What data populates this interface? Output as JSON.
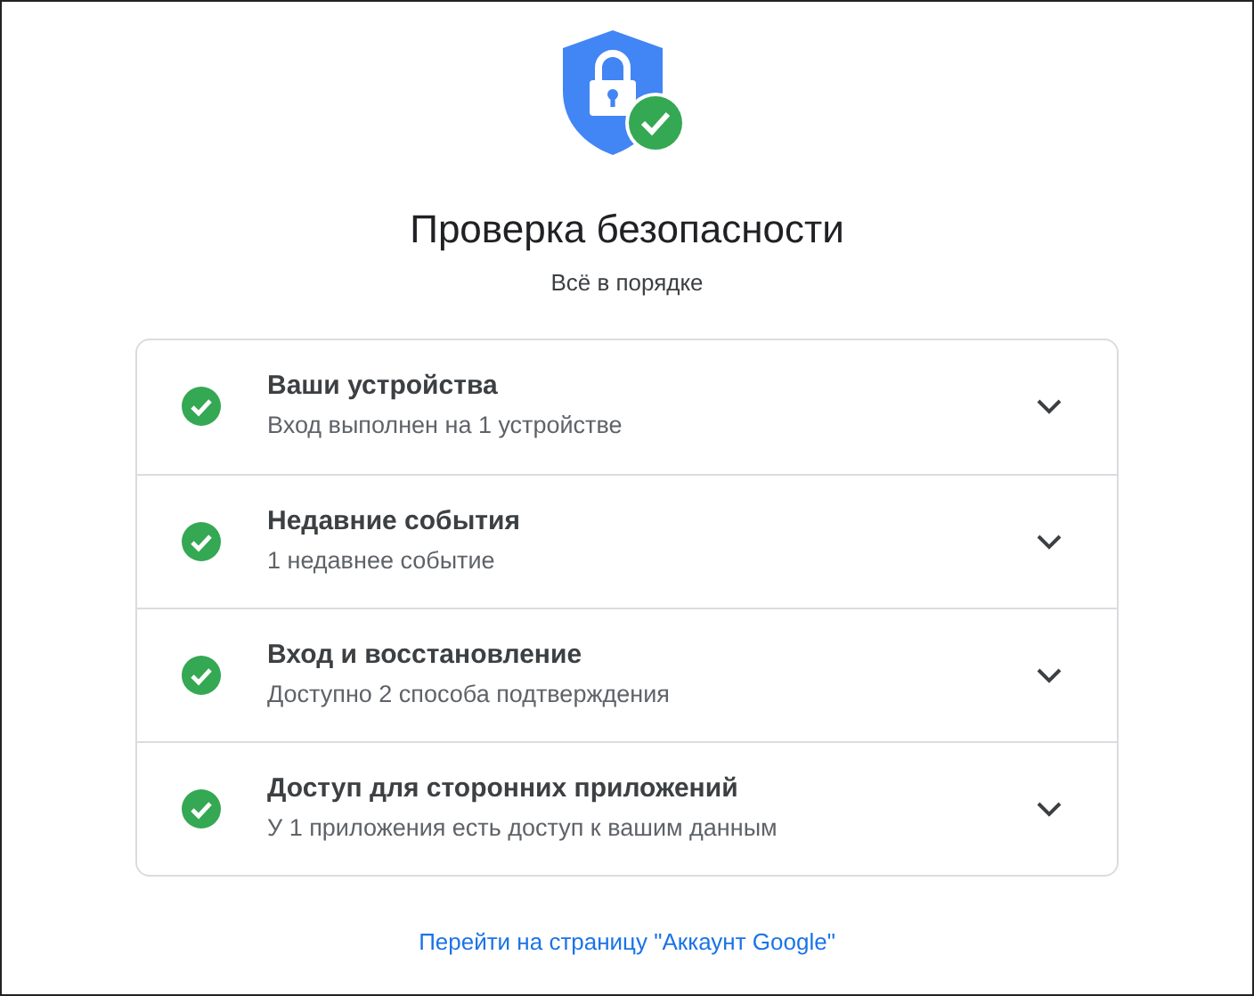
{
  "header": {
    "title": "Проверка безопасности",
    "subtitle": "Всё в порядке"
  },
  "items": [
    {
      "title": "Ваши устройства",
      "detail": "Вход выполнен на 1 устройстве",
      "expanded": false
    },
    {
      "title": "Недавние события",
      "detail": "1 недавнее событие",
      "expanded": false
    },
    {
      "title": "Вход и восстановление",
      "detail": "Доступно 2 способа подтверждения",
      "expanded": false
    },
    {
      "title": "Доступ для сторонних приложений",
      "detail": "У 1 приложения есть доступ к вашим данным",
      "expanded": false
    }
  ],
  "footer_link": "Перейти на страницу \"Аккаунт Google\""
}
